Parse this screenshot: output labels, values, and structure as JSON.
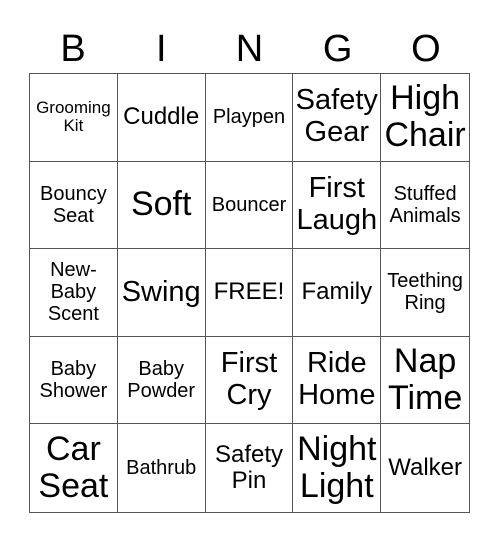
{
  "header": {
    "letters": [
      "B",
      "I",
      "N",
      "G",
      "O"
    ]
  },
  "cells": [
    {
      "text": "Grooming Kit",
      "size": "s1"
    },
    {
      "text": "Cuddle",
      "size": "s3"
    },
    {
      "text": "Playpen",
      "size": "s2"
    },
    {
      "text": "Safety Gear",
      "size": "s4"
    },
    {
      "text": "High Chair",
      "size": "s5"
    },
    {
      "text": "Bouncy Seat",
      "size": "s2"
    },
    {
      "text": "Soft",
      "size": "s5"
    },
    {
      "text": "Bouncer",
      "size": "s2"
    },
    {
      "text": "First Laugh",
      "size": "s4"
    },
    {
      "text": "Stuffed Animals",
      "size": "s2"
    },
    {
      "text": "New-Baby Scent",
      "size": "s2"
    },
    {
      "text": "Swing",
      "size": "s4"
    },
    {
      "text": "FREE!",
      "size": "s3"
    },
    {
      "text": "Family",
      "size": "s3"
    },
    {
      "text": "Teething Ring",
      "size": "s2"
    },
    {
      "text": "Baby Shower",
      "size": "s2"
    },
    {
      "text": "Baby Powder",
      "size": "s2"
    },
    {
      "text": "First Cry",
      "size": "s4"
    },
    {
      "text": "Ride Home",
      "size": "s4"
    },
    {
      "text": "Nap Time",
      "size": "s5"
    },
    {
      "text": "Car Seat",
      "size": "s5"
    },
    {
      "text": "Bathrub",
      "size": "s2"
    },
    {
      "text": "Safety Pin",
      "size": "s3"
    },
    {
      "text": "Night Light",
      "size": "s5"
    },
    {
      "text": "Walker",
      "size": "s3"
    }
  ]
}
